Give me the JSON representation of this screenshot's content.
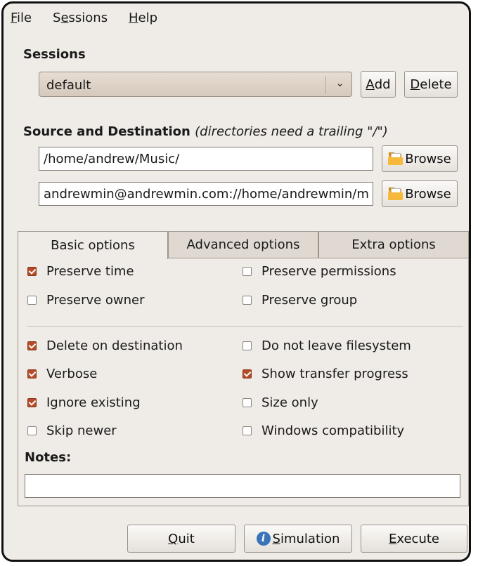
{
  "menubar": {
    "items": [
      {
        "mnemonic": "F",
        "rest": "ile"
      },
      {
        "prefix": "S",
        "mnemonic": "e",
        "rest": "ssions"
      },
      {
        "mnemonic": "H",
        "rest": "elp"
      }
    ]
  },
  "sessions": {
    "title": "Sessions",
    "selected": "default",
    "add": {
      "mnemonic": "A",
      "rest": "dd"
    },
    "delete": {
      "mnemonic": "D",
      "rest": "elete"
    }
  },
  "source_dest": {
    "title": "Source and Destination",
    "hint": "(directories need a trailing \"/\")",
    "source_value": "/home/andrew/Music/",
    "dest_value": "andrewmin@andrewmin.com://home/andrewmin/m",
    "browse_label": "Browse"
  },
  "tabs": [
    "Basic options",
    "Advanced options",
    "Extra options"
  ],
  "options": {
    "preserve_time": {
      "label": "Preserve time",
      "checked": true
    },
    "preserve_permissions": {
      "label": "Preserve permissions",
      "checked": false
    },
    "preserve_owner": {
      "label": "Preserve owner",
      "checked": false
    },
    "preserve_group": {
      "label": "Preserve group",
      "checked": false
    },
    "delete_on_destination": {
      "label": "Delete on destination",
      "checked": true
    },
    "do_not_leave_filesystem": {
      "label": "Do not leave filesystem",
      "checked": false
    },
    "verbose": {
      "label": "Verbose",
      "checked": true
    },
    "show_transfer_progress": {
      "label": "Show transfer progress",
      "checked": true
    },
    "ignore_existing": {
      "label": "Ignore existing",
      "checked": true
    },
    "size_only": {
      "label": "Size only",
      "checked": false
    },
    "skip_newer": {
      "label": "Skip newer",
      "checked": false
    },
    "windows_compatibility": {
      "label": "Windows compatibility",
      "checked": false
    }
  },
  "notes": {
    "title": "Notes:",
    "value": ""
  },
  "footer": {
    "quit": {
      "mnemonic": "Q",
      "rest": "uit"
    },
    "simulation": {
      "mnemonic": "S",
      "rest": "imulation",
      "icon": "info-icon"
    },
    "execute": {
      "mnemonic": "E",
      "rest": "xecute"
    }
  },
  "colors": {
    "checked": "#b44a27",
    "window_bg": "#efebe7"
  }
}
